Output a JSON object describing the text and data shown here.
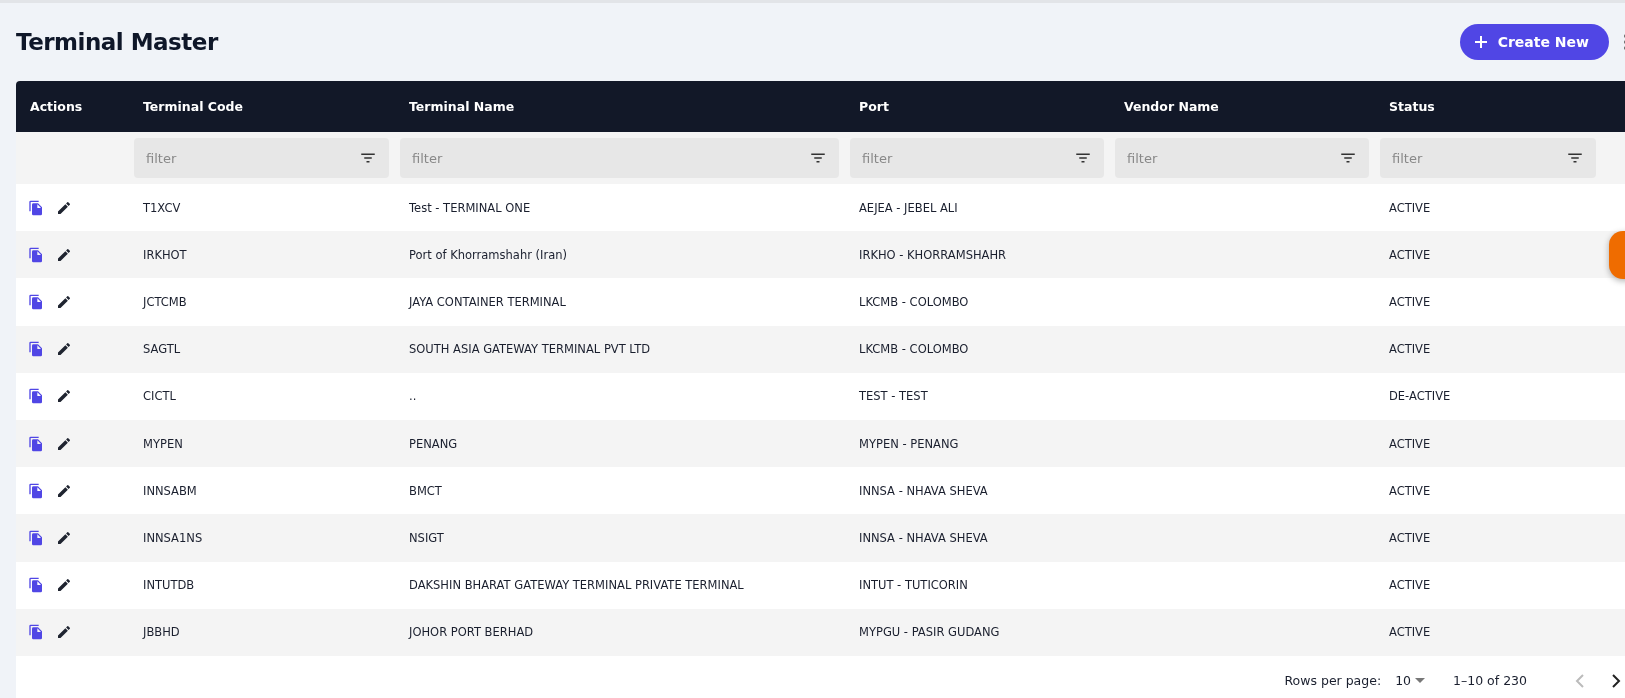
{
  "page": {
    "title": "Terminal Master",
    "create_button": "Create New"
  },
  "table": {
    "columns": [
      "Actions",
      "Terminal Code",
      "Terminal Name",
      "Port",
      "Vendor Name",
      "Status"
    ],
    "filters": [
      {
        "placeholder": "filter"
      },
      {
        "placeholder": "filter"
      },
      {
        "placeholder": "filter"
      },
      {
        "placeholder": "filter"
      },
      {
        "placeholder": "filter"
      }
    ],
    "rows": [
      {
        "code": "T1XCV",
        "name": "Test - TERMINAL ONE",
        "port": "AEJEA - JEBEL ALI",
        "vendor": "",
        "status": "ACTIVE"
      },
      {
        "code": "IRKHOT",
        "name": "Port of Khorramshahr (Iran)",
        "port": "IRKHO - KHORRAMSHAHR",
        "vendor": "",
        "status": "ACTIVE"
      },
      {
        "code": "JCTCMB",
        "name": "JAYA CONTAINER TERMINAL",
        "port": "LKCMB - COLOMBO",
        "vendor": "",
        "status": "ACTIVE"
      },
      {
        "code": "SAGTL",
        "name": "SOUTH ASIA GATEWAY TERMINAL PVT LTD",
        "port": "LKCMB - COLOMBO",
        "vendor": "",
        "status": "ACTIVE"
      },
      {
        "code": "CICTL",
        "name": "..",
        "port": "TEST - TEST",
        "vendor": "",
        "status": "DE-ACTIVE"
      },
      {
        "code": "MYPEN",
        "name": "PENANG",
        "port": "MYPEN - PENANG",
        "vendor": "",
        "status": "ACTIVE"
      },
      {
        "code": "INNSABM",
        "name": "BMCT",
        "port": "INNSA - NHAVA SHEVA",
        "vendor": "",
        "status": "ACTIVE"
      },
      {
        "code": "INNSA1NS",
        "name": "NSIGT",
        "port": "INNSA - NHAVA SHEVA",
        "vendor": "",
        "status": "ACTIVE"
      },
      {
        "code": "INTUTDB",
        "name": "DAKSHIN BHARAT GATEWAY TERMINAL PRIVATE TERMINAL",
        "port": "INTUT - TUTICORIN",
        "vendor": "",
        "status": "ACTIVE"
      },
      {
        "code": "JBBHD",
        "name": "JOHOR PORT BERHAD",
        "port": "MYPGU - PASIR GUDANG",
        "vendor": "",
        "status": "ACTIVE"
      }
    ]
  },
  "pagination": {
    "rows_per_page_label": "Rows per page:",
    "rows_per_page": "10",
    "range": "1–10 of 230",
    "previous": {
      "disabled": true
    },
    "next": {
      "disabled": false
    }
  }
}
